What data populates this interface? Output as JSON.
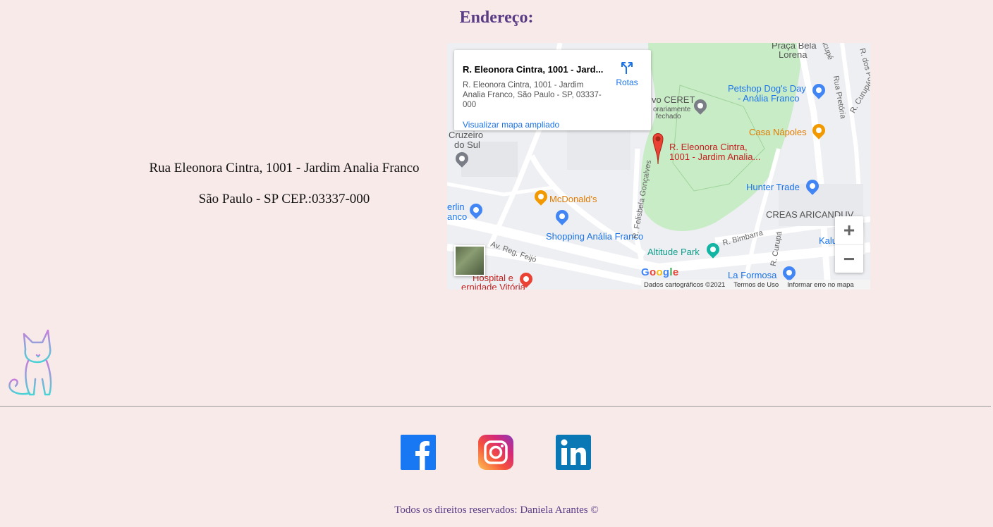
{
  "section_title": "Endereço:",
  "address": {
    "line1": "Rua Eleonora Cintra, 1001 - Jardim Analia Franco",
    "line2": "São Paulo - SP CEP.:03337-000"
  },
  "map": {
    "info_title": "R. Eleonora Cintra, 1001 - Jard...",
    "info_address": "R. Eleonora Cintra, 1001 - Jardim Analia Franco, São Paulo - SP, 03337-000",
    "view_larger": "Visualizar mapa ampliado",
    "directions": "Rotas",
    "labels": {
      "praca1": "Praça Bela",
      "praca2": "Lorena",
      "petshop1": "Petshop Dog's Day",
      "petshop2": "- Anália Franco",
      "ceret": "vo CERET",
      "ceret_status1": "orariamente",
      "ceret_status2": "fechado",
      "casa": "Casa Nápoles",
      "cruzeiro1": "Cruzeiro",
      "cruzeiro2": "do Sul",
      "pin1": "R. Eleonora Cintra,",
      "pin2": "1001 - Jardim Analia...",
      "hunter": "Hunter Trade",
      "mcd": "McDonald's",
      "creas": "CREAS ARICANDUV",
      "berlin1": "erlin",
      "berlin2": "anco",
      "shopping": "Shopping Anália Franco",
      "altitude": "Altitude Park",
      "kal": "Kalu",
      "feijo": "Av. Reg. Feijó",
      "hospital1": "Hospital e",
      "hospital2": "ernidade Vitória",
      "formosa": "La Formosa",
      "bimbarra": "R. Bimbarra",
      "curupa1": "R. Curupá",
      "curupa2": "R. Curupá",
      "pretoria": "Rua Pretória",
      "felisbela": "R. Felisbela Gonçalves",
      "jacupe": "Jacupé",
      "dospo": "R. dos Po"
    },
    "google": "Google",
    "map_data": "Dados cartográficos ©2021",
    "terms": "Termos de Uso",
    "report": "Informar erro no mapa",
    "zoom_in": "+",
    "zoom_out": "−"
  },
  "social": {
    "facebook": "facebook-icon",
    "instagram": "instagram-icon",
    "linkedin": "linkedin-icon"
  },
  "footer": {
    "copyright": "Todos os direitos reservados: Daniela Arantes ©"
  },
  "colors": {
    "background": "#f9eaea",
    "title": "#5b3d86",
    "park": "#c8ecc6"
  }
}
